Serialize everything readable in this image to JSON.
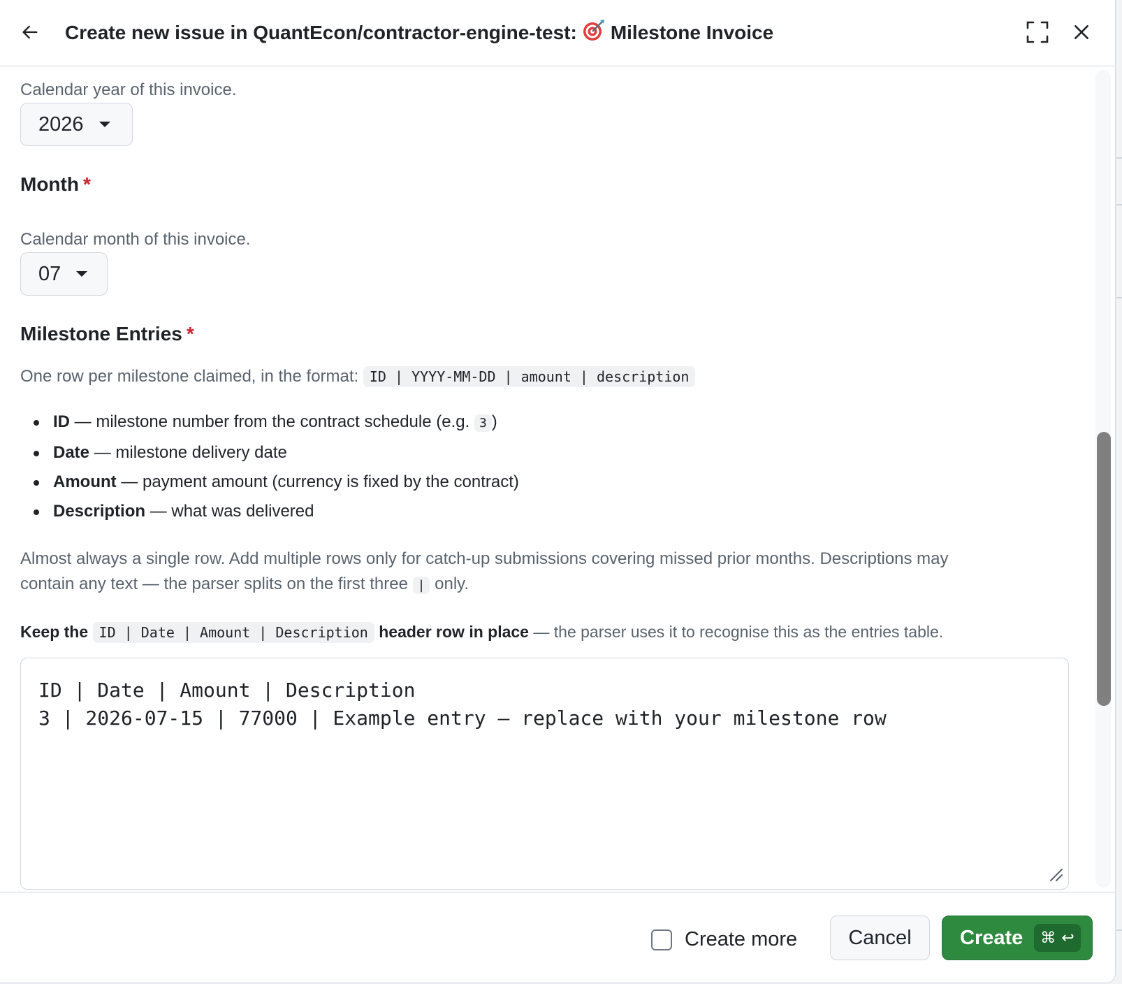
{
  "header": {
    "title": "Create new issue in QuantEcon/contractor-engine-test:",
    "template_name": "Milestone Invoice"
  },
  "year": {
    "help": "Calendar year of this invoice.",
    "value": "2026"
  },
  "month": {
    "label": "Month",
    "required": "*",
    "help": "Calendar month of this invoice.",
    "value": "07"
  },
  "entries": {
    "label": "Milestone Entries",
    "required": "*",
    "format_intro": "One row per milestone claimed, in the format:",
    "format_code": "ID | YYYY-MM-DD | amount | description",
    "bullets": [
      {
        "term": "ID",
        "desc": " — milestone number from the contract schedule (e.g. ",
        "code": "3",
        "after": ")"
      },
      {
        "term": "Date",
        "desc": " — milestone delivery date"
      },
      {
        "term": "Amount",
        "desc": " — payment amount (currency is fixed by the contract)"
      },
      {
        "term": "Description",
        "desc": " — what was delivered"
      }
    ],
    "note_line1": "Almost always a single row. Add multiple rows only for catch-up submissions covering missed prior months. Descriptions may",
    "note_line2_pre": "contain any text — the parser splits on the first three",
    "note_line2_code": "|",
    "note_line2_post": "only.",
    "keep_pre": "Keep the",
    "keep_code": "ID | Date | Amount | Description",
    "keep_bold": "header row in place",
    "keep_post": " — the parser uses it to recognise this as the entries table.",
    "textarea_value": "ID | Date | Amount | Description\n3 | 2026-07-15 | 77000 | Example entry — replace with your milestone row"
  },
  "footer": {
    "create_more": "Create more",
    "cancel": "Cancel",
    "create": "Create",
    "shortcut_cmd": "⌘",
    "shortcut_enter": "↩"
  },
  "colors": {
    "primary_button": "#2d8a3e",
    "required": "#cf222e",
    "muted_text": "#59636e"
  }
}
